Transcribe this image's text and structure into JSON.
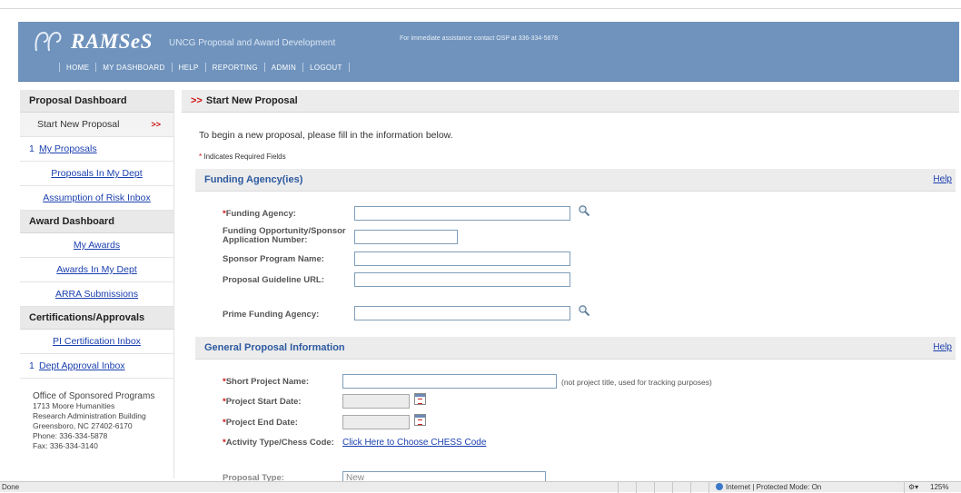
{
  "header": {
    "app_name": "RAMSeS",
    "subtitle": "UNCG Proposal and Award Development",
    "contact": "For immediate assistance contact OSP at 336-334-5878",
    "nav": [
      "HOME",
      "MY DASHBOARD",
      "HELP",
      "REPORTING",
      "ADMIN",
      "LOGOUT"
    ]
  },
  "sidebar": {
    "proposal_head": "Proposal Dashboard",
    "start_new": "Start New Proposal",
    "active_arrow": ">>",
    "my_proposals_count": "1",
    "my_proposals": "My Proposals",
    "proposals_dept": "Proposals In My Dept",
    "assumption_risk": "Assumption of Risk Inbox",
    "award_head": "Award Dashboard",
    "my_awards": "My Awards",
    "awards_dept": "Awards In My Dept",
    "arra": "ARRA Submissions",
    "cert_head": "Certifications/Approvals",
    "pi_cert": "PI Certification Inbox",
    "dept_approval_count": "1",
    "dept_approval": "Dept Approval Inbox",
    "office": {
      "name": "Office of Sponsored Programs",
      "line1": "1713 Moore Humanities",
      "line2": "Research Administration Building",
      "line3": "Greensboro, NC 27402-6170",
      "phone": "Phone: 336-334-5878",
      "fax": "Fax: 336-334-3140"
    }
  },
  "main": {
    "page_arrow": ">>",
    "page_title": "Start New Proposal",
    "intro": "To begin a new proposal, please fill in the information below.",
    "required_star": "*",
    "required_note": "Indicates Required Fields",
    "help_label": "Help",
    "funding": {
      "title": "Funding Agency(ies)",
      "agency_label": "Funding Agency:",
      "opportunity_label_1": "Funding Opportunity/Sponsor",
      "opportunity_label_2": "Application Number:",
      "program_label": "Sponsor Program Name:",
      "guideline_label": "Proposal Guideline URL:",
      "prime_label": "Prime Funding Agency:"
    },
    "general": {
      "title": "General Proposal Information",
      "short_name_label": "Short Project Name:",
      "short_name_note": "(not project title, used for tracking purposes)",
      "start_label": "Project Start Date:",
      "end_label": "Project End Date:",
      "activity_label": "Activity Type/Chess Code:",
      "chess_link": "Click Here to Choose CHESS Code",
      "proposal_type_label": "Proposal Type:",
      "proposal_type_value": "New"
    }
  },
  "statusbar": {
    "status": "Done",
    "zone": "Internet | Protected Mode: On",
    "zoom": "125%"
  },
  "colors": {
    "banner": "#6f93bd",
    "link": "#1a3fae",
    "section_title": "#2d5aa0",
    "required": "#d01010"
  }
}
